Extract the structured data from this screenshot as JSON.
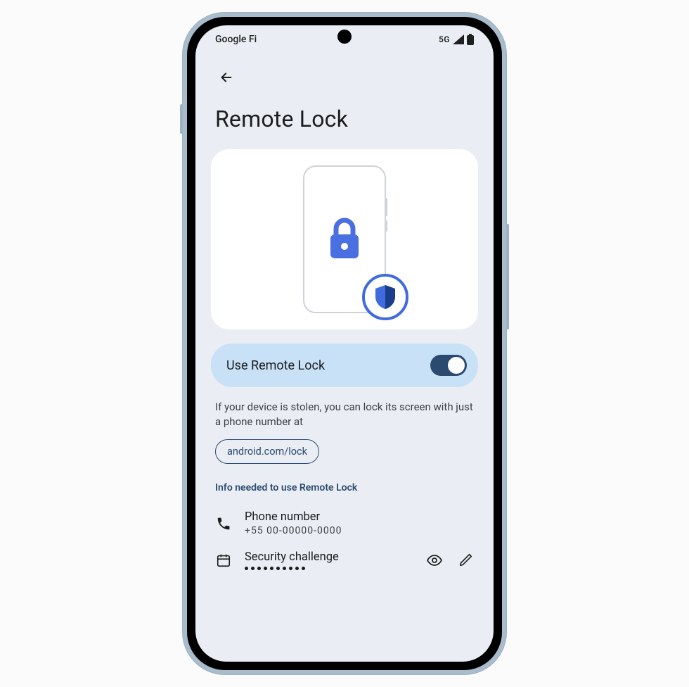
{
  "status_bar": {
    "carrier": "Google Fi",
    "network_label": "5G"
  },
  "header": {
    "title": "Remote Lock"
  },
  "toggle": {
    "label": "Use Remote Lock",
    "on": true
  },
  "description": "If your device is stolen, you can lock its screen with just a phone number at",
  "lock_link": "android.com/lock",
  "section_hint": "Info needed to use Remote Lock",
  "items": {
    "phone": {
      "title": "Phone number",
      "value": "+55 00-00000-0000"
    },
    "security": {
      "title": "Security challenge"
    }
  },
  "icons": {
    "back": "arrow-back",
    "lock": "lock",
    "shield": "shield",
    "phone": "phone",
    "calendar": "calendar",
    "eye": "visibility",
    "edit": "edit"
  },
  "colors": {
    "lock_blue": "#4a6fe0",
    "shield_dark": "#1a3e8c",
    "tile_bg": "#c8e1f6",
    "accent_deep": "#2b4a6f",
    "screen_bg": "#eaeef4"
  }
}
